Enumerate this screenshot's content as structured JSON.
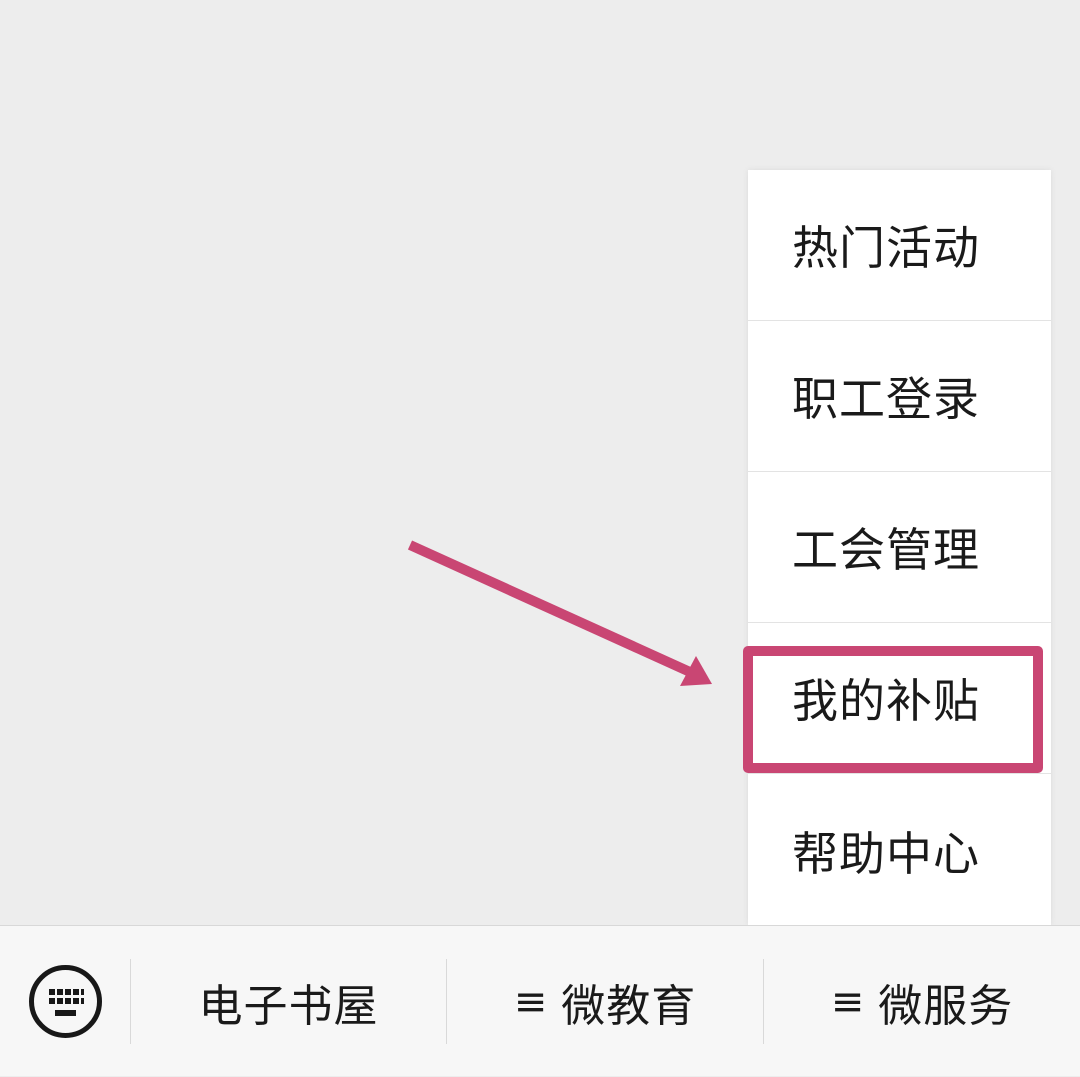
{
  "menu": {
    "items": [
      {
        "label": "热门活动"
      },
      {
        "label": "职工登录"
      },
      {
        "label": "工会管理"
      },
      {
        "label": "我的补贴"
      },
      {
        "label": "帮助中心"
      }
    ],
    "highlighted_index": 3
  },
  "annotation": {
    "color": "#c94673"
  },
  "bottom_bar": {
    "keyboard_icon": "keyboard-icon",
    "tabs": [
      {
        "label": "电子书屋",
        "has_submenu": false
      },
      {
        "label": "微教育",
        "has_submenu": true,
        "submenu_icon": "≡"
      },
      {
        "label": "微服务",
        "has_submenu": true,
        "submenu_icon": "≡"
      }
    ]
  }
}
